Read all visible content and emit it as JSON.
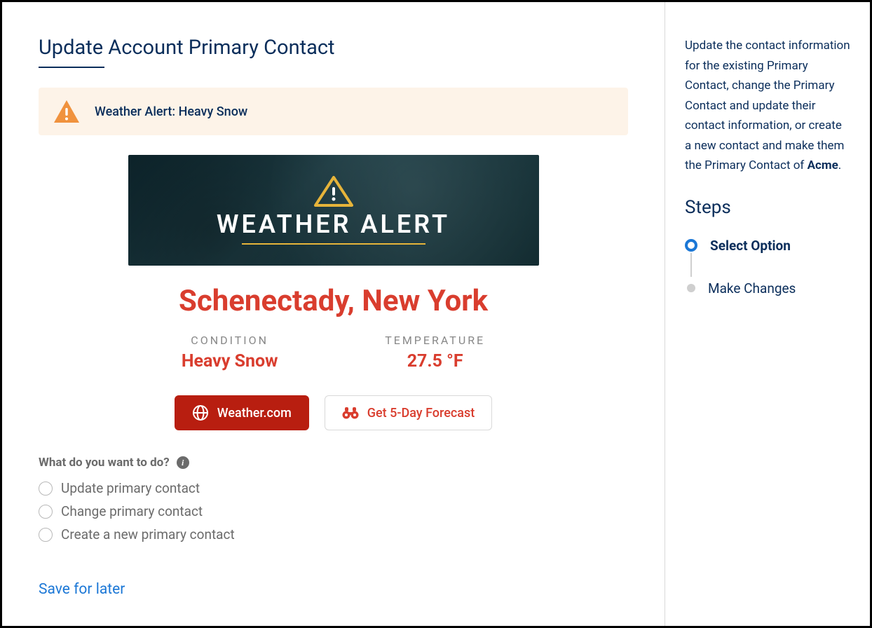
{
  "page": {
    "title": "Update Account Primary Contact"
  },
  "alert": {
    "text": "Weather Alert: Heavy Snow"
  },
  "hero": {
    "title": "WEATHER ALERT"
  },
  "weather": {
    "location": "Schenectady, New York",
    "condition_label": "CONDITION",
    "condition_value": "Heavy Snow",
    "temperature_label": "TEMPERATURE",
    "temperature_value": "27.5 °F"
  },
  "buttons": {
    "weather_com": "Weather.com",
    "forecast": "Get 5-Day Forecast"
  },
  "question": {
    "label": "What do you want to do?",
    "options": [
      "Update primary contact",
      "Change primary contact",
      "Create a new primary contact"
    ]
  },
  "footer": {
    "save": "Save for later"
  },
  "sidebar": {
    "desc_prefix": "Update the contact information for the existing Primary Contact, change the Primary Contact and update their contact information, or create a new contact and make them the Primary Contact of ",
    "desc_bold": "Acme",
    "desc_suffix": ".",
    "steps_heading": "Steps",
    "steps": [
      {
        "label": "Select Option",
        "active": true
      },
      {
        "label": "Make Changes",
        "active": false
      }
    ]
  }
}
